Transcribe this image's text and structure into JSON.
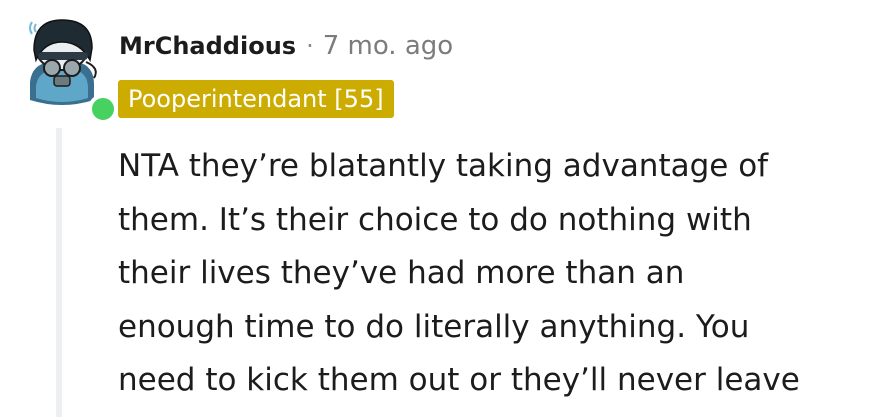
{
  "comment": {
    "username": "MrChaddious",
    "separator": "·",
    "timestamp": "7 mo. ago",
    "flair": "Pooperintendant [55]",
    "body_lines": [
      "NTA they’re blatantly taking advantage of",
      "them. It’s their choice to do nothing with",
      "their lives they’ve had more than an",
      "enough time to do literally anything. You",
      "need to kick them out or they’ll never leave"
    ],
    "colors": {
      "flair_bg": "#ccac00",
      "online": "#46d160",
      "thread_line": "#edeff1"
    },
    "icons": [
      "snoo-avatar-icon",
      "online-status-icon"
    ]
  }
}
